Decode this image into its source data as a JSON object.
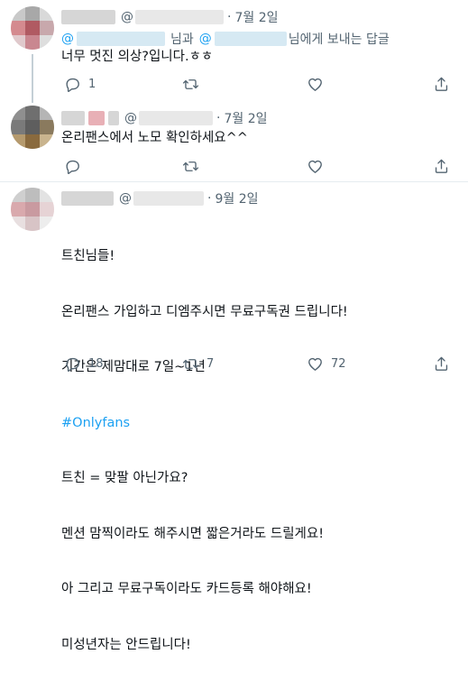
{
  "tweets": [
    {
      "date": "7월 2일",
      "at": "@",
      "reply_to": {
        "at1": "@",
        "and": "님과",
        "at2": "@",
        "suffix": "님에게 보내는 답글"
      },
      "lines": [
        "너무 멋진 의상?입니다.ㅎㅎ"
      ],
      "reply_count": "1",
      "retweet_count": "",
      "like_count": ""
    },
    {
      "date": "7월 2일",
      "at": "@",
      "lines": [
        "온리팬스에서 노모 확인하세요^^"
      ],
      "reply_count": "",
      "retweet_count": "",
      "like_count": ""
    },
    {
      "date": "9월 2일",
      "at": "@",
      "lines": [
        "트친님들!",
        "온리팬스 가입하고 디엠주시면 무료구독권 드립니다!",
        "기간은 제맘대로 7일~1년",
        "#Onlyfans",
        "트친 = 맞팔 아닌가요?",
        "멘션 맘찍이라도 해주시면 짧은거라도 드릴게요!",
        "아 그리고 무료구독이라도 카드등록 해야해요!",
        "미성년자는 안드립니다!"
      ],
      "reply_count": "18",
      "retweet_count": "7",
      "like_count": "72"
    }
  ],
  "icons": {
    "reply": "reply-icon",
    "retweet": "retweet-icon",
    "like": "heart-icon",
    "share": "share-icon"
  },
  "colors": {
    "link": "#1da1f2",
    "secondary_text": "#536471",
    "primary_text": "#0f1419",
    "divider": "#e6ecf0"
  }
}
